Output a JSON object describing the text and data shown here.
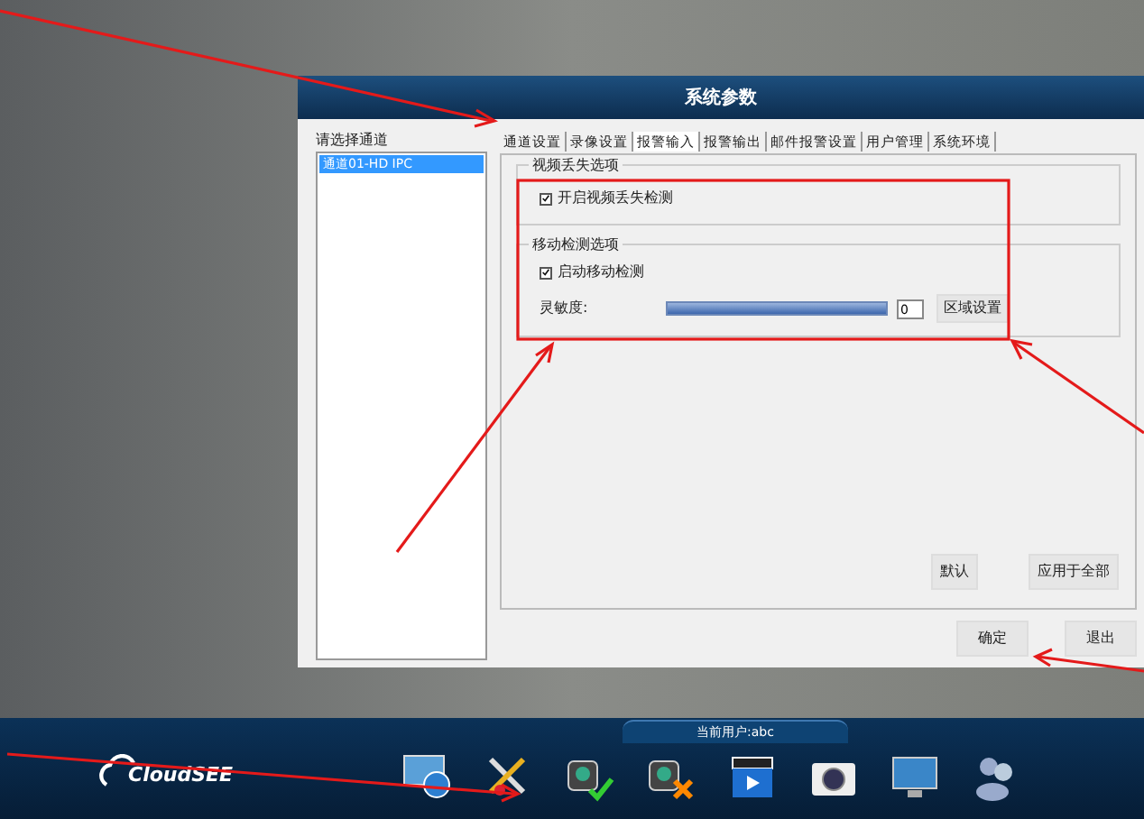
{
  "dialog": {
    "title": "系统参数",
    "channel_list": {
      "label": "请选择通道",
      "items": [
        {
          "label": "通道01-HD IPC",
          "selected": true
        }
      ]
    },
    "tabs": [
      {
        "label": "通道设置",
        "selected": false
      },
      {
        "label": "录像设置",
        "selected": false
      },
      {
        "label": "报警输入",
        "selected": true
      },
      {
        "label": "报警输出",
        "selected": false
      },
      {
        "label": "邮件报警设置",
        "selected": false
      },
      {
        "label": "用户管理",
        "selected": false
      },
      {
        "label": "系统环境",
        "selected": false
      }
    ],
    "video_loss": {
      "title": "视频丢失选项",
      "checkbox": {
        "label": "开启视频丢失检测",
        "checked": true
      }
    },
    "motion": {
      "title": "移动检测选项",
      "checkbox": {
        "label": "启动移动检测",
        "checked": true
      },
      "sensitivity": {
        "label": "灵敏度:",
        "level": 1,
        "value": "0"
      },
      "region_button": "区域设置"
    },
    "panel_buttons": [
      "默认",
      "应用于全部"
    ],
    "buttons": [
      "确定",
      "退出"
    ]
  },
  "taskbar": {
    "user": "当前用户:abc",
    "logo": "CloudSEE",
    "toolbar": [
      {
        "kind": "devices"
      },
      {
        "kind": "settings"
      },
      {
        "kind": "record-all"
      },
      {
        "kind": "stop-all"
      },
      {
        "kind": "playback"
      },
      {
        "kind": "snapshot"
      },
      {
        "kind": "layout"
      },
      {
        "kind": "login"
      }
    ]
  }
}
